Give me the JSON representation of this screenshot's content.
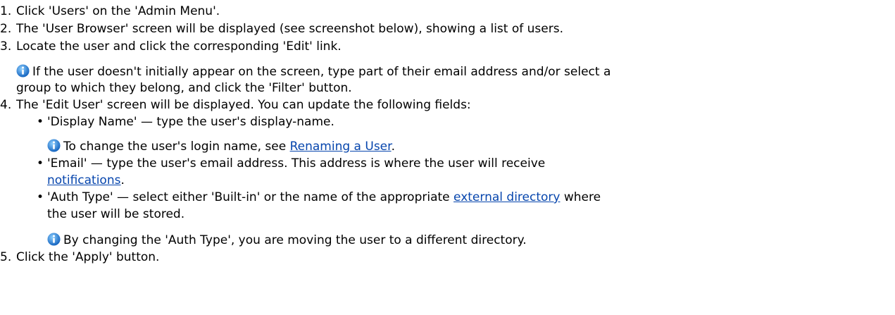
{
  "steps": [
    {
      "num": "1.",
      "text": "Click 'Users' on the 'Admin Menu'."
    },
    {
      "num": "2.",
      "text": "The 'User Browser' screen will be displayed (see screenshot below), showing a list of users."
    },
    {
      "num": "3.",
      "text": "Locate the user and click the corresponding 'Edit' link."
    },
    {
      "num": "4.",
      "text": "The 'Edit User' screen will be displayed. You can update the following fields:"
    },
    {
      "num": "5.",
      "text": "Click the 'Apply' button."
    }
  ],
  "note_step3": {
    "line1": "If the user doesn't initially appear on the screen, type part of their email address and/or select a",
    "line2": "group to which they belong, and click the 'Filter' button."
  },
  "fields": {
    "display_name": {
      "text": "'Display Name' — type the user's display-name.",
      "note_prefix": "To change the user's login name, see ",
      "note_link": "Renaming a User",
      "note_suffix": "."
    },
    "email": {
      "text": "'Email' — type the user's email address. This address is where the user will receive",
      "link": "notifications",
      "link_suffix": "."
    },
    "auth_type": {
      "text_prefix": "'Auth Type' — select either 'Built-in' or the name of the appropriate ",
      "link": "external directory",
      "text_suffix": " where",
      "line2": "the user will be stored.",
      "note": "By changing the 'Auth Type', you are moving the user to a different directory."
    }
  },
  "colors": {
    "link": "#0645ad",
    "info_icon": "#1e90ff"
  },
  "icons": {
    "info": "info-icon",
    "bullet": "bullet-dot"
  }
}
